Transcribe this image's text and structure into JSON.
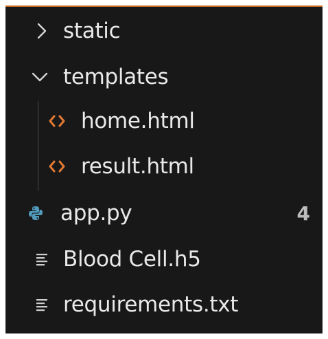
{
  "explorer": {
    "items": [
      {
        "label": "static",
        "type": "folder",
        "state": "collapsed",
        "icon": "chevron-right-icon"
      },
      {
        "label": "templates",
        "type": "folder",
        "state": "expanded",
        "icon": "chevron-down-icon"
      },
      {
        "label": "home.html",
        "type": "file",
        "icon": "html-file-icon",
        "icon_color": "#e37933"
      },
      {
        "label": "result.html",
        "type": "file",
        "icon": "html-file-icon",
        "icon_color": "#e37933"
      },
      {
        "label": "app.py",
        "type": "file",
        "icon": "python-file-icon",
        "icon_color": "#519aba",
        "badge": "4"
      },
      {
        "label": "Blood Cell.h5",
        "type": "file",
        "icon": "text-file-icon"
      },
      {
        "label": "requirements.txt",
        "type": "file",
        "icon": "text-file-icon"
      }
    ]
  },
  "colors": {
    "background": "#181818",
    "accent_top": "#c26a22",
    "text": "#e9e9e9",
    "badge": "#bdbdbd"
  }
}
